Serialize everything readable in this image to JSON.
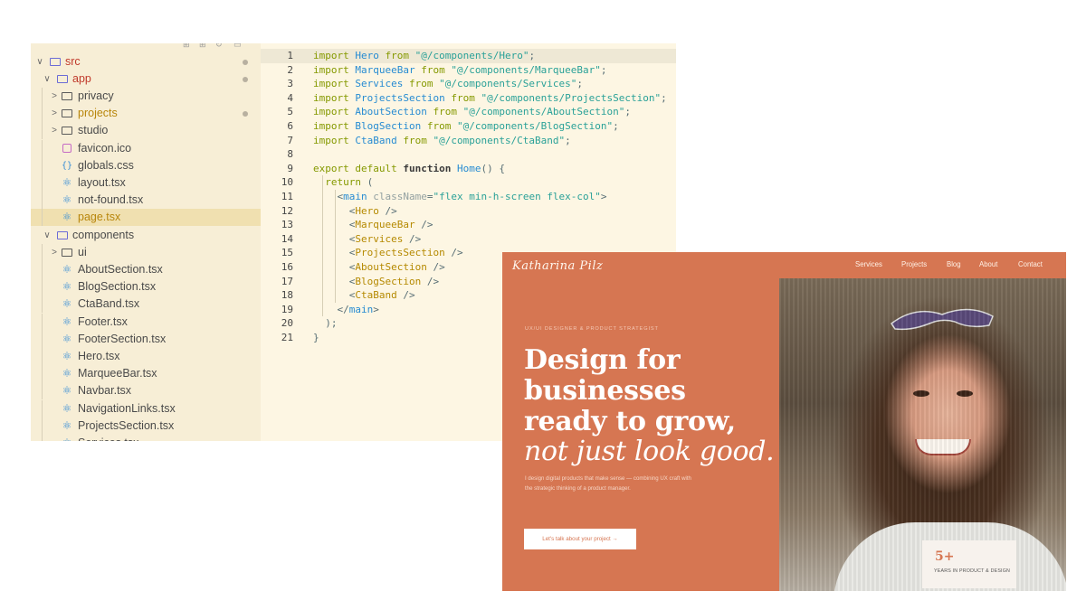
{
  "explorer": {
    "top_glyphs": [
      "⊞",
      "⊞",
      "↻",
      "▭"
    ],
    "rows": [
      {
        "label": "src",
        "chevron": "⌄",
        "icon": "folder-special",
        "depth": 0,
        "color": "#c0392b",
        "dot": true
      },
      {
        "label": "app",
        "chevron": "⌄",
        "icon": "folder-special",
        "depth": 1,
        "color": "#c0392b",
        "dot": true
      },
      {
        "label": "privacy",
        "chevron": "›",
        "icon": "folder",
        "depth": 2,
        "color": "#4a4a4a",
        "dot": false
      },
      {
        "label": "projects",
        "chevron": "›",
        "icon": "folder",
        "depth": 2,
        "color": "#b8860b",
        "dot": true
      },
      {
        "label": "studio",
        "chevron": "›",
        "icon": "folder",
        "depth": 2,
        "color": "#4a4a4a",
        "dot": false
      },
      {
        "label": "favicon.ico",
        "chevron": "",
        "icon": "image",
        "depth": 2,
        "color": "#4a4a4a",
        "dot": false
      },
      {
        "label": "globals.css",
        "chevron": "",
        "icon": "css",
        "depth": 2,
        "color": "#4a4a4a",
        "dot": false
      },
      {
        "label": "layout.tsx",
        "chevron": "",
        "icon": "react",
        "depth": 2,
        "color": "#4a4a4a",
        "dot": false
      },
      {
        "label": "not-found.tsx",
        "chevron": "",
        "icon": "react",
        "depth": 2,
        "color": "#4a4a4a",
        "dot": false
      },
      {
        "label": "page.tsx",
        "chevron": "",
        "icon": "react",
        "depth": 2,
        "color": "#b8860b",
        "dot": false,
        "selected": true
      },
      {
        "label": "components",
        "chevron": "⌄",
        "icon": "folder-special",
        "depth": 1,
        "color": "#4a4a4a",
        "dot": false
      },
      {
        "label": "ui",
        "chevron": "›",
        "icon": "folder",
        "depth": 2,
        "color": "#4a4a4a",
        "dot": false
      },
      {
        "label": "AboutSection.tsx",
        "chevron": "",
        "icon": "react",
        "depth": 2,
        "color": "#4a4a4a",
        "dot": false
      },
      {
        "label": "BlogSection.tsx",
        "chevron": "",
        "icon": "react",
        "depth": 2,
        "color": "#4a4a4a",
        "dot": false
      },
      {
        "label": "CtaBand.tsx",
        "chevron": "",
        "icon": "react",
        "depth": 2,
        "color": "#4a4a4a",
        "dot": false
      },
      {
        "label": "Footer.tsx",
        "chevron": "",
        "icon": "react",
        "depth": 2,
        "color": "#4a4a4a",
        "dot": false
      },
      {
        "label": "FooterSection.tsx",
        "chevron": "",
        "icon": "react",
        "depth": 2,
        "color": "#4a4a4a",
        "dot": false
      },
      {
        "label": "Hero.tsx",
        "chevron": "",
        "icon": "react",
        "depth": 2,
        "color": "#4a4a4a",
        "dot": false
      },
      {
        "label": "MarqueeBar.tsx",
        "chevron": "",
        "icon": "react",
        "depth": 2,
        "color": "#4a4a4a",
        "dot": false
      },
      {
        "label": "Navbar.tsx",
        "chevron": "",
        "icon": "react",
        "depth": 2,
        "color": "#4a4a4a",
        "dot": false
      },
      {
        "label": "NavigationLinks.tsx",
        "chevron": "",
        "icon": "react",
        "depth": 2,
        "color": "#4a4a4a",
        "dot": false
      },
      {
        "label": "ProjectsSection.tsx",
        "chevron": "",
        "icon": "react",
        "depth": 2,
        "color": "#4a4a4a",
        "dot": false
      },
      {
        "label": "Services.tsx",
        "chevron": "",
        "icon": "react",
        "depth": 2,
        "color": "#4a4a4a",
        "dot": false
      }
    ]
  },
  "editor": {
    "active_line": 1,
    "lines": [
      [
        [
          "import ",
          "kw"
        ],
        [
          "Hero",
          "id"
        ],
        [
          " from ",
          "kw"
        ],
        [
          "\"@/components/Hero\"",
          "str"
        ],
        [
          ";",
          "p"
        ]
      ],
      [
        [
          "import ",
          "kw"
        ],
        [
          "MarqueeBar",
          "id"
        ],
        [
          " from ",
          "kw"
        ],
        [
          "\"@/components/MarqueeBar\"",
          "str"
        ],
        [
          ";",
          "p"
        ]
      ],
      [
        [
          "import ",
          "kw"
        ],
        [
          "Services",
          "id"
        ],
        [
          " from ",
          "kw"
        ],
        [
          "\"@/components/Services\"",
          "str"
        ],
        [
          ";",
          "p"
        ]
      ],
      [
        [
          "import ",
          "kw"
        ],
        [
          "ProjectsSection",
          "id"
        ],
        [
          " from ",
          "kw"
        ],
        [
          "\"@/components/ProjectsSection\"",
          "str"
        ],
        [
          ";",
          "p"
        ]
      ],
      [
        [
          "import ",
          "kw"
        ],
        [
          "AboutSection",
          "id"
        ],
        [
          " from ",
          "kw"
        ],
        [
          "\"@/components/AboutSection\"",
          "str"
        ],
        [
          ";",
          "p"
        ]
      ],
      [
        [
          "import ",
          "kw"
        ],
        [
          "BlogSection",
          "id"
        ],
        [
          " from ",
          "kw"
        ],
        [
          "\"@/components/BlogSection\"",
          "str"
        ],
        [
          ";",
          "p"
        ]
      ],
      [
        [
          "import ",
          "kw"
        ],
        [
          "CtaBand",
          "id"
        ],
        [
          " from ",
          "kw"
        ],
        [
          "\"@/components/CtaBand\"",
          "str"
        ],
        [
          ";",
          "p"
        ]
      ],
      [],
      [
        [
          "export default ",
          "kw"
        ],
        [
          "function ",
          "fn-kw"
        ],
        [
          "Home",
          "fn"
        ],
        [
          "() {",
          "p"
        ]
      ],
      [
        [
          "  return ",
          "kw"
        ],
        [
          "(",
          "p"
        ]
      ],
      [
        [
          "    <",
          "p"
        ],
        [
          "main",
          "tag"
        ],
        [
          " className",
          "attr"
        ],
        [
          "=",
          "p"
        ],
        [
          "\"flex min-h-screen flex-col\"",
          "str"
        ],
        [
          ">",
          "p"
        ]
      ],
      [
        [
          "      <",
          "p"
        ],
        [
          "Hero",
          "comp"
        ],
        [
          " />",
          "p"
        ]
      ],
      [
        [
          "      <",
          "p"
        ],
        [
          "MarqueeBar",
          "comp"
        ],
        [
          " />",
          "p"
        ]
      ],
      [
        [
          "      <",
          "p"
        ],
        [
          "Services",
          "comp"
        ],
        [
          " />",
          "p"
        ]
      ],
      [
        [
          "      <",
          "p"
        ],
        [
          "ProjectsSection",
          "comp"
        ],
        [
          " />",
          "p"
        ]
      ],
      [
        [
          "      <",
          "p"
        ],
        [
          "AboutSection",
          "comp"
        ],
        [
          " />",
          "p"
        ]
      ],
      [
        [
          "      <",
          "p"
        ],
        [
          "BlogSection",
          "comp"
        ],
        [
          " />",
          "p"
        ]
      ],
      [
        [
          "      <",
          "p"
        ],
        [
          "CtaBand",
          "comp"
        ],
        [
          " />",
          "p"
        ]
      ],
      [
        [
          "    </",
          "p"
        ],
        [
          "main",
          "tag"
        ],
        [
          ">",
          "p"
        ]
      ],
      [
        [
          "  );",
          "p"
        ]
      ],
      [
        [
          "}",
          "p"
        ]
      ]
    ],
    "colors": {
      "kw": "#859900",
      "fn-kw": "#3a3a3a",
      "id": "#268bd2",
      "str": "#2aa198",
      "p": "#586e75",
      "fn": "#268bd2",
      "tag": "#268bd2",
      "attr": "#93a1a1",
      "comp": "#b58900"
    }
  },
  "site": {
    "logo": "Katharina Pilz",
    "nav": [
      "Services",
      "Projects",
      "Blog",
      "About",
      "Contact"
    ],
    "kicker": "UX/UI DESIGNER & PRODUCT STRATEGIST",
    "headline": [
      "Design for",
      "businesses",
      "ready to grow,"
    ],
    "headline_italic": "not just look good.",
    "description": "I design digital products that make sense — combining UX craft with the strategic thinking of a product manager.",
    "cta_label": "Let's talk about your project →",
    "badge_number": "5+",
    "badge_label": "YEARS IN PRODUCT & DESIGN",
    "accent_color": "#d67652"
  }
}
